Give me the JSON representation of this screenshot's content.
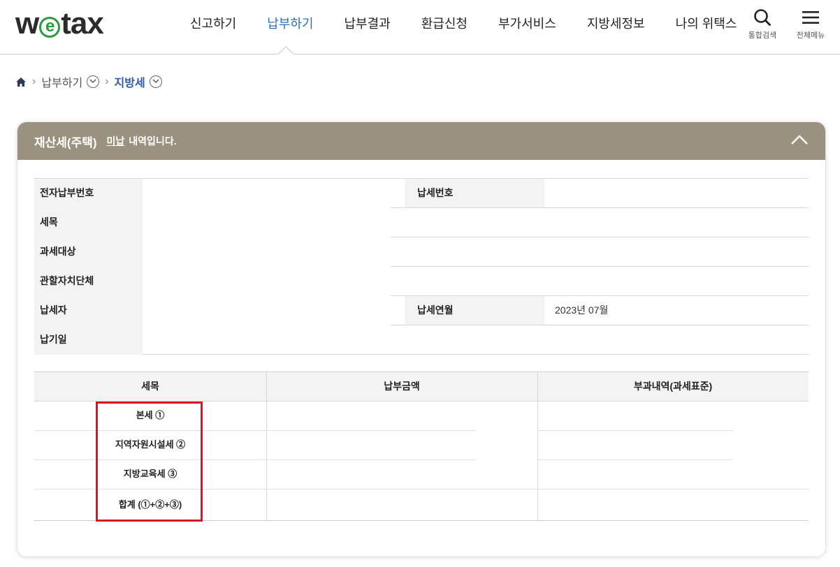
{
  "header": {
    "logo": {
      "prefix": "w",
      "e": "e",
      "suffix": "tax"
    },
    "nav": [
      {
        "label": "신고하기",
        "active": false
      },
      {
        "label": "납부하기",
        "active": true
      },
      {
        "label": "납부결과",
        "active": false
      },
      {
        "label": "환급신청",
        "active": false
      },
      {
        "label": "부가서비스",
        "active": false
      },
      {
        "label": "지방세정보",
        "active": false
      },
      {
        "label": "나의 위택스",
        "active": false
      }
    ],
    "search_label": "통합검색",
    "menu_label": "전체메뉴"
  },
  "breadcrumb": {
    "level1": "납부하기",
    "level2": "지방세"
  },
  "panel": {
    "title": "재산세(주택)",
    "status": "미납",
    "status_suffix": "내역입니다.",
    "info": {
      "e_payment_no": "전자납부번호",
      "tax_no": "납세번호",
      "tax_item": "세목",
      "tax_object": "과세대상",
      "jurisdiction": "관할자치단체",
      "taxpayer": "납세자",
      "tax_period": "납세연월",
      "tax_period_value": "2023년 07월",
      "due_date": "납기일"
    },
    "amount_table": {
      "headers": [
        "세목",
        "납부금액",
        "부과내역(과세표준)"
      ],
      "rows": [
        "본세 ①",
        "지역자원시설세 ②",
        "지방교육세 ③",
        "합계 (①+②+③)"
      ]
    }
  },
  "colors": {
    "panel_header": "#9a917f",
    "nav_active": "#2f6fb4",
    "highlight": "#e0121d"
  }
}
